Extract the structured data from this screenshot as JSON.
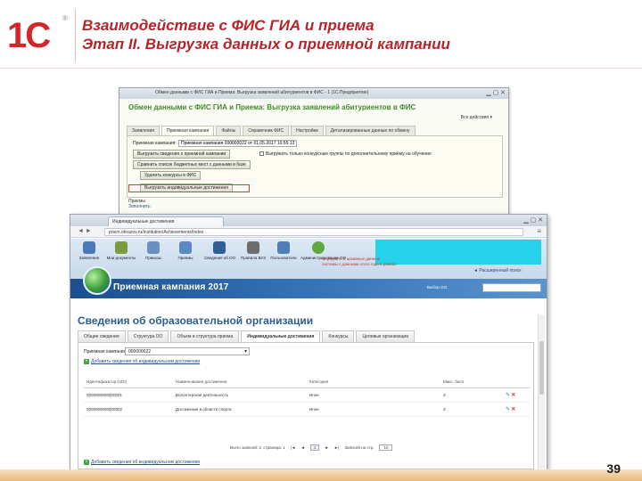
{
  "slide": {
    "logo_text": "1С",
    "logo_reg": "®",
    "title_line1": "Взаимодействие с ФИС ГИА и приема",
    "title_line2": "Этап II. Выгрузка данных о приемной кампании",
    "page_number": "39"
  },
  "window1c": {
    "title": "Обмен данными с ФИС ГИА и Приема: Выгрузка заявлений абитуриентов в ФИС - 1 (1С:Предприятие)",
    "heading": "Обмен данными с ФИС ГИА и Приема: Выгрузка заявлений абитуриентов в ФИС",
    "more": "Все действия ▾",
    "tabs": [
      "Заявления",
      "Приемная кампания",
      "Файлы",
      "Справочник ФИС",
      "Настройки",
      "Детализированные данные по обмену"
    ],
    "campaign_label": "Приемная кампания:",
    "campaign_value": "Приемная кампания 000000022 от 01.05.2017 10:55:13",
    "buttons": [
      "Выгрузить сведения о приемной кампании",
      "Сравнить список бюджетных мест с данными в базе",
      "Удалить конкурсы в ФИС",
      "Выгрузить индивидуальные достижения"
    ],
    "checkbox_label": "Выгружать только конкурсные группы по дополнительному приёму на обучение",
    "bottom_label": "Приемы",
    "bottom_link": "Заполнить"
  },
  "browser": {
    "tab_title": "Индивидуальные достижения",
    "url": "priem.obrazov.ru/Institution/Achievements/Index",
    "toolbar": [
      {
        "label": "Заявления",
        "color": "#4b78b8"
      },
      {
        "label": "Мои документы",
        "color": "#7a9c3a"
      },
      {
        "label": "Приказы",
        "color": "#6b8fbf"
      },
      {
        "label": "Приемы",
        "color": "#5a88c4"
      },
      {
        "label": "Сведения об ОО",
        "color": "#2f5f99"
      },
      {
        "label": "Правила ВУЗ",
        "color": "#6d6d6d"
      },
      {
        "label": "Пользователи",
        "color": "#4f7fb5"
      },
      {
        "label": "Администрирование ОО",
        "color": "#5ea83f"
      }
    ],
    "notice_line1": "Передайте в архивные данные",
    "notice_line2": "системы с данными этого года в рамках",
    "search_link": "◄ Расширенный поиск",
    "banner_title": "Приемная кампания 2017",
    "org_label": "Выбор ОО",
    "page_heading": "Сведения об образовательной организации",
    "tabs": [
      "Общие сведения",
      "Структура ОО",
      "Объем и структура приема",
      "Индивидуальные достижения",
      "Конкурсы",
      "Целевые организации"
    ],
    "active_tab": 3,
    "campaign_label": "Приемная кампания",
    "campaign_value": "000000022",
    "add_link": "Добавить сведения об индивидуальном достижении",
    "table_headers": [
      "Идентификатор (UID)",
      "Наименование достижения",
      "Категория",
      "Макс. балл"
    ],
    "rows": [
      [
        "0000000000000001",
        "Волонтерская деятельность",
        "Иное",
        "3"
      ],
      [
        "0000000000000002",
        "Достижения в области спорта",
        "Иное",
        "3"
      ]
    ],
    "pager_text": "Всего записей: 2, страница: 1",
    "pager_first": "|◄",
    "pager_prev": "◄",
    "pager_page": "1",
    "pager_next": "►",
    "pager_last": "►|",
    "pager_size_label": "Записей на стр.",
    "pager_size": "10"
  },
  "colors": {
    "title": "#b5252a",
    "logo": "#d7242a",
    "heading_1c": "#3c8b2d",
    "banner": "#1b4f8f",
    "teal": "#26d2ea"
  }
}
